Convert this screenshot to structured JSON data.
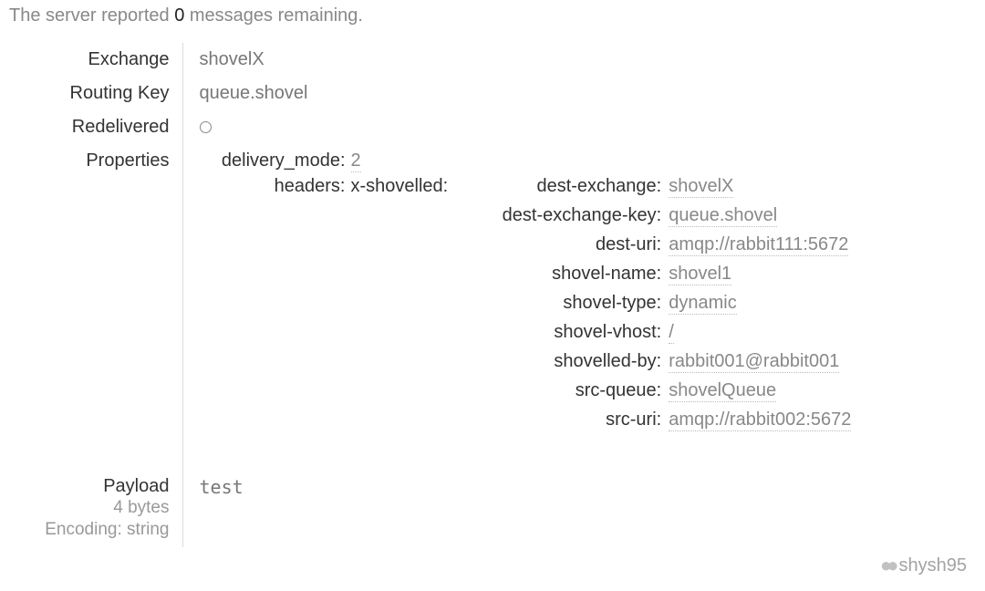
{
  "status": {
    "prefix": "The server reported",
    "count": "0",
    "suffix": "messages remaining."
  },
  "labels": {
    "exchange": "Exchange",
    "routing_key": "Routing Key",
    "redelivered": "Redelivered",
    "properties": "Properties",
    "payload": "Payload"
  },
  "exchange": "shovelX",
  "routing_key": "queue.shovel",
  "properties": {
    "delivery_mode_key": "delivery_mode:",
    "delivery_mode_val": "2",
    "headers_key": "headers:",
    "x_shovelled_key": "x-shovelled:",
    "shovelled": [
      {
        "key": "dest-exchange:",
        "val": "shovelX"
      },
      {
        "key": "dest-exchange-key:",
        "val": "queue.shovel"
      },
      {
        "key": "dest-uri:",
        "val": "amqp://rabbit111:5672"
      },
      {
        "key": "shovel-name:",
        "val": "shovel1"
      },
      {
        "key": "shovel-type:",
        "val": "dynamic"
      },
      {
        "key": "shovel-vhost:",
        "val": "/"
      },
      {
        "key": "shovelled-by:",
        "val": "rabbit001@rabbit001"
      },
      {
        "key": "src-queue:",
        "val": "shovelQueue"
      },
      {
        "key": "src-uri:",
        "val": "amqp://rabbit002:5672"
      }
    ]
  },
  "payload": {
    "size": "4 bytes",
    "encoding": "Encoding: string",
    "value": "test"
  },
  "watermark": "shysh95"
}
